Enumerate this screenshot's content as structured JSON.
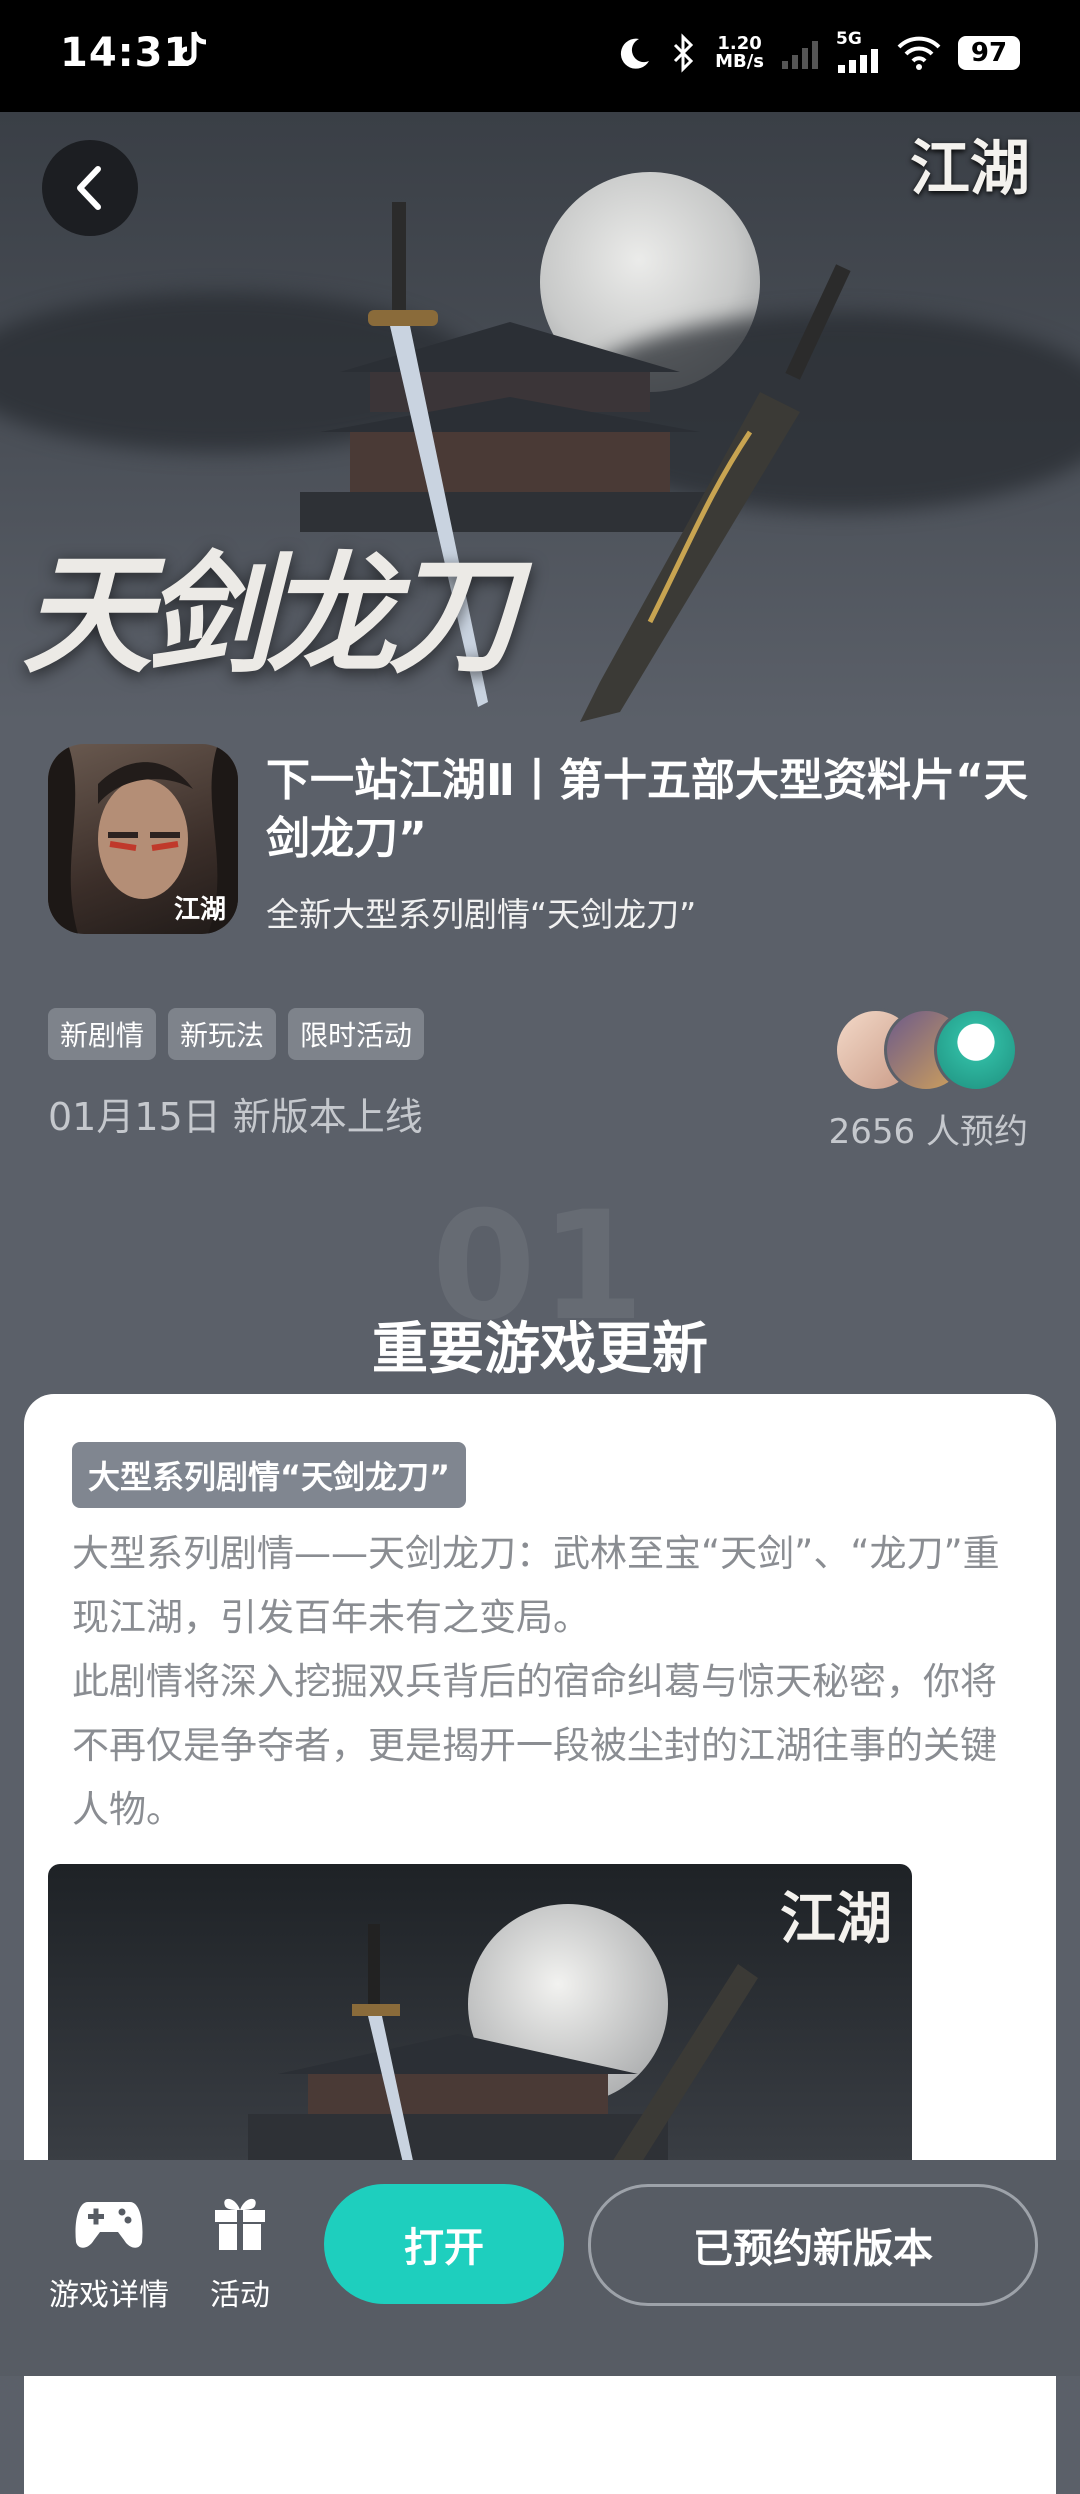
{
  "status_bar": {
    "time": "14:31",
    "net_speed_value": "1.20",
    "net_speed_unit": "MB/s",
    "network": "5G",
    "battery": "97"
  },
  "hero": {
    "title": "天剑龙刀",
    "corner_logo": "江湖"
  },
  "game": {
    "title": "下一站江湖Ⅱ丨第十五部大型资料片“天剑龙刀”",
    "subtitle": "全新大型系列剧情“天剑龙刀”",
    "icon_label": "江湖"
  },
  "tags": [
    "新剧情",
    "新玩法",
    "限时活动"
  ],
  "release_text": "01月15日 新版本上线",
  "reservation_text": "2656 人预约",
  "section": {
    "number": "01",
    "title": "重要游戏更新"
  },
  "card": {
    "tag": "大型系列剧情“天剑龙刀”",
    "paragraph_1": "大型系列剧情——天剑龙刀：武林至宝“天剑”、“龙刀”重现江湖，引发百年未有之变局。",
    "paragraph_2": "此剧情将深入挖掘双兵背后的宿命纠葛与惊天秘密，你将不再仅是争夺者，更是揭开一段被尘封的江湖往事的关键人物。",
    "image_logo": "江湖"
  },
  "bottom_bar": {
    "details_label": "游戏详情",
    "activity_label": "活动",
    "open_label": "打开",
    "reserved_label": "已预约新版本"
  },
  "colors": {
    "accent": "#1ecfbe",
    "page_bg": "#5b6069"
  }
}
